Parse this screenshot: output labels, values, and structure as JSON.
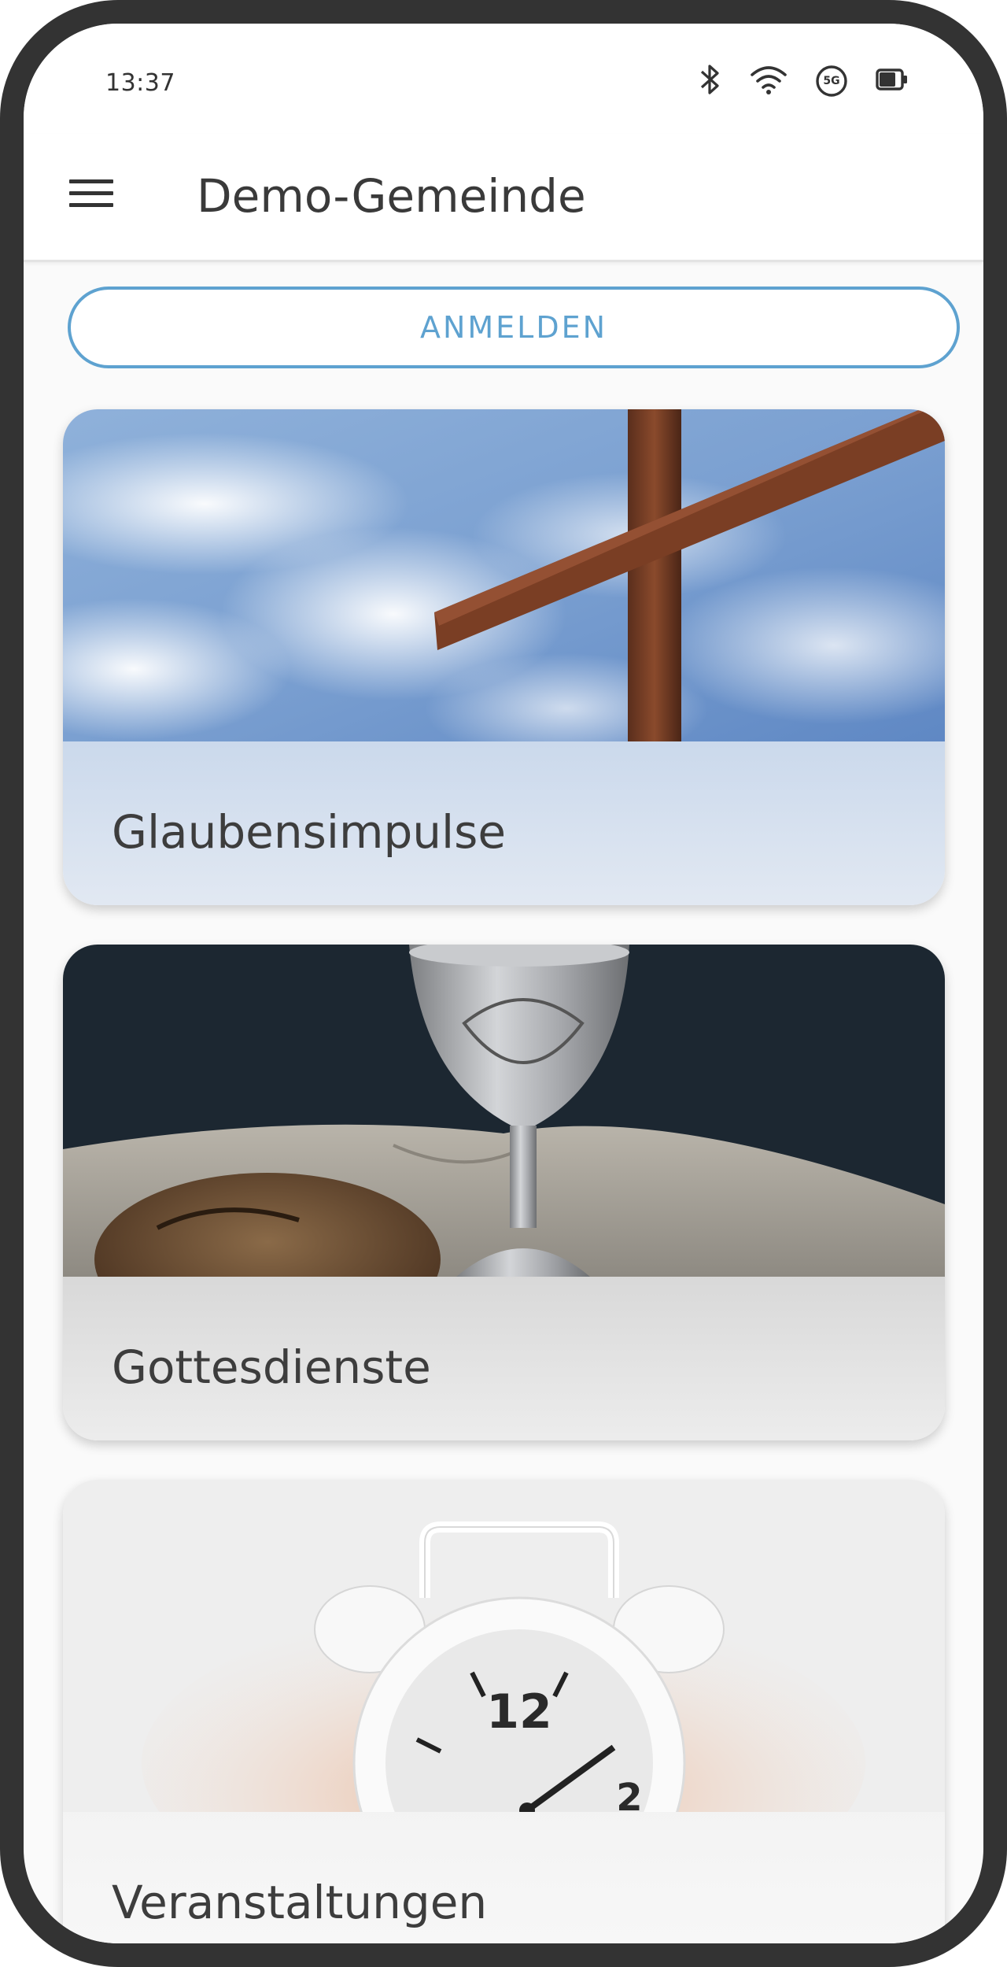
{
  "status_bar": {
    "time": "13:37",
    "icons": [
      "bluetooth-icon",
      "wifi-icon",
      "5g-icon",
      "battery-icon"
    ],
    "network_label": "5G"
  },
  "app_bar": {
    "title": "Demo-Gemeinde",
    "menu_icon": "hamburger-menu-icon"
  },
  "login_button": {
    "label": "ANMELDEN"
  },
  "cards": [
    {
      "label": "Glaubensimpulse",
      "image": "cross-against-sky"
    },
    {
      "label": "Gottesdienste",
      "image": "chalice-and-bread"
    },
    {
      "label": "Veranstaltungen",
      "image": "alarm-clock-in-hand"
    }
  ],
  "colors": {
    "accent": "#5ea2d0",
    "frame": "#333333",
    "text": "#3a3a3a"
  }
}
